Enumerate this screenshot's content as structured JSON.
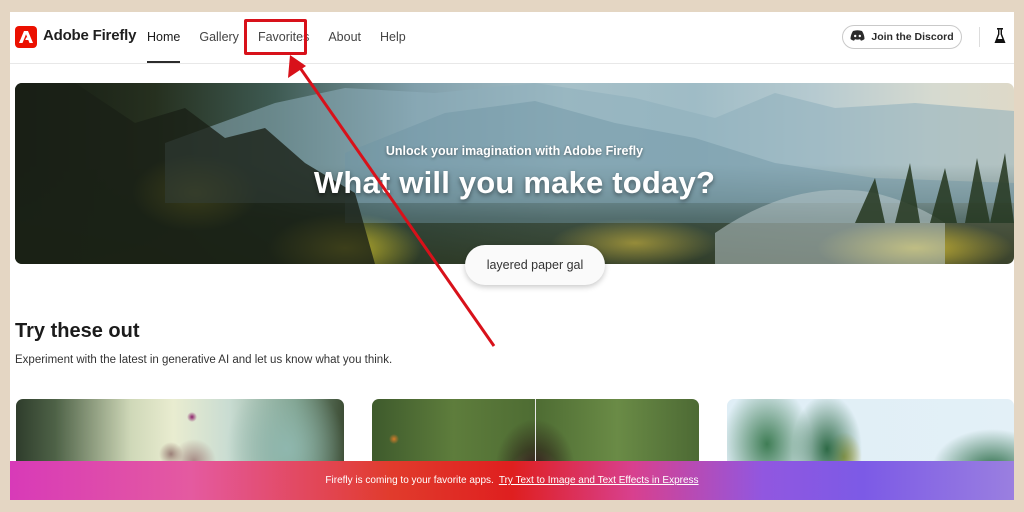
{
  "header": {
    "brand": "Adobe Firefly",
    "nav": [
      {
        "label": "Home",
        "active": true
      },
      {
        "label": "Gallery",
        "active": false
      },
      {
        "label": "Favorites",
        "active": false
      },
      {
        "label": "About",
        "active": false
      },
      {
        "label": "Help",
        "active": false
      }
    ],
    "discord_label": "Join the Discord",
    "icons": {
      "logo": "adobe-logo-icon",
      "discord": "discord-icon",
      "labs": "flask-icon"
    }
  },
  "hero": {
    "subtitle": "Unlock your imagination with Adobe Firefly",
    "title": "What will you make today?",
    "prompt_value": "layered paper gal"
  },
  "section": {
    "title": "Try these out",
    "description": "Experiment with the latest in generative AI and let us know what you think."
  },
  "cards": [
    {
      "name": "fantasy-forest-card"
    },
    {
      "name": "portrait-card"
    },
    {
      "name": "tropical-leaves-card"
    }
  ],
  "banner": {
    "text": "Firefly is coming to your favorite apps.",
    "link": "Try Text to Image and Text Effects in Express"
  },
  "annotation": {
    "highlight_target": "Favorites",
    "highlight_color": "#d8111a"
  },
  "colors": {
    "brand_red": "#eb1000",
    "frame_bg": "#e4d6c3"
  }
}
